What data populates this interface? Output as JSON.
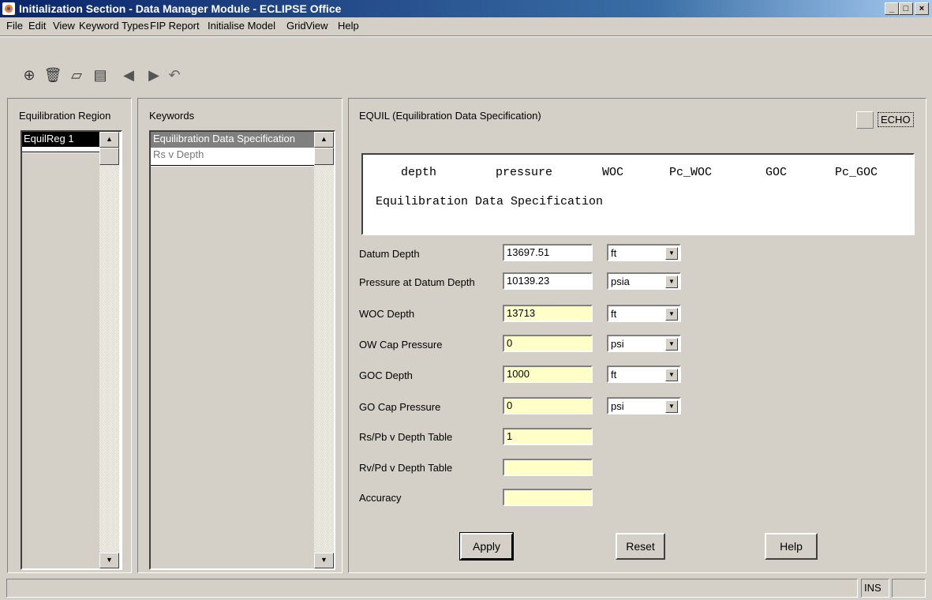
{
  "window": {
    "title": "Initialization Section - Data Manager Module - ECLIPSE Office",
    "controls": [
      "_",
      "□",
      "×"
    ]
  },
  "menu": {
    "items": [
      "File",
      "Edit",
      "View",
      "Keyword Types",
      "FIP Report",
      "Initialise Model",
      "GridView",
      "Help"
    ]
  },
  "toolbar": {
    "icons": [
      "crosshair-icon",
      "trash-icon",
      "cube-icon",
      "report-icon",
      "back-arrow-icon",
      "forward-arrow-icon",
      "undo-arrow-icon"
    ]
  },
  "regions": {
    "header": "Equilibration Region",
    "items": [
      "EquilReg 1"
    ]
  },
  "keywords": {
    "header": "Keywords",
    "items": [
      "Equilibration Data Specification",
      "Rs v Depth"
    ]
  },
  "detail": {
    "header": "EQUIL (Equilibration Data Specification)",
    "echo_label": "ECHO",
    "preview_columns": [
      "depth",
      "pressure",
      "WOC",
      "Pc_WOC",
      "GOC",
      "Pc_GOC"
    ],
    "preview_text": "Equilibration Data Specification",
    "fields": [
      {
        "label": "Datum Depth",
        "value": "13697.51",
        "unit": "ft"
      },
      {
        "label": "Pressure at Datum Depth",
        "value": "10139.23",
        "unit": "psia"
      },
      {
        "label": "WOC Depth",
        "value": "13713",
        "unit": "ft"
      },
      {
        "label": "OW Cap Pressure",
        "value": "0",
        "unit": "psi"
      },
      {
        "label": "GOC Depth",
        "value": "1000",
        "unit": "ft"
      },
      {
        "label": "GO Cap Pressure",
        "value": "0",
        "unit": "psi"
      },
      {
        "label": "Rs/Pb v Depth Table",
        "value": "1"
      },
      {
        "label": "Rv/Pd v Depth Table",
        "value": ""
      },
      {
        "label": "Accuracy",
        "value": ""
      }
    ],
    "buttons": {
      "apply": "Apply",
      "reset": "Reset",
      "help": "Help"
    }
  },
  "statusbar": {
    "mode": "INS"
  }
}
